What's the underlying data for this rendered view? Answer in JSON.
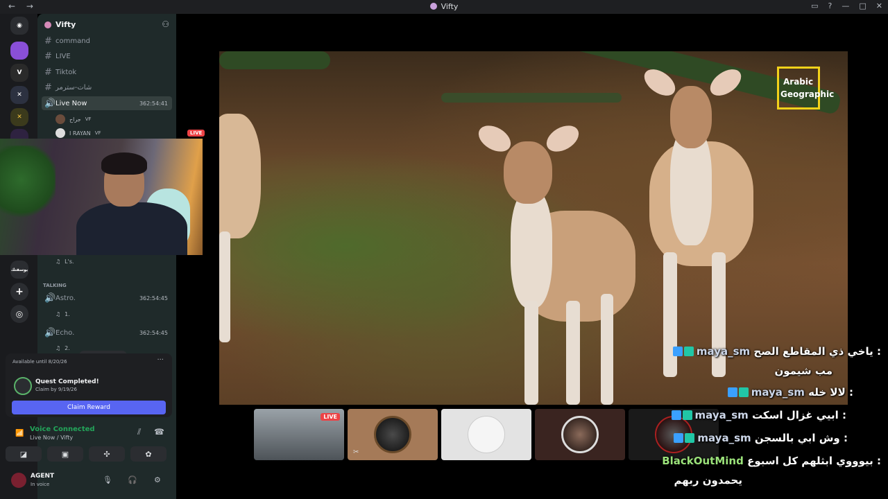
{
  "window": {
    "title": "Vifty"
  },
  "server": {
    "name": "Vifty"
  },
  "channels": [
    {
      "name": "command"
    },
    {
      "name": "LIVE"
    },
    {
      "name": "Tiktok"
    },
    {
      "name": "شات-سترمر"
    }
  ],
  "live_channel": {
    "name": "Live Now",
    "time": "362:54:41",
    "badge": "LIVE"
  },
  "voice_users": [
    {
      "name": "جراح",
      "tag": "VF"
    },
    {
      "name": "I RAYAN",
      "tag": "VF"
    }
  ],
  "other_user": {
    "name": "L's."
  },
  "category_talking": "TALKING",
  "talking_channels": [
    {
      "name": "Astro.",
      "time": "362:54:45",
      "user": "1."
    },
    {
      "name": "Echo.",
      "time": "362:54:45",
      "user": "2."
    }
  ],
  "new_unreads": "NEW UNREADS",
  "quest": {
    "available": "Available until 8/20/26",
    "title": "Quest Completed!",
    "subtitle": "Claim by 9/19/26",
    "button": "Claim Reward"
  },
  "voice_panel": {
    "status": "Voice Connected",
    "channel": "Live Now / Vifty"
  },
  "user_panel": {
    "name": "AGENT",
    "status": "In voice"
  },
  "watermark": {
    "line1": "Arabic",
    "line2": "Geographic"
  },
  "thumbnails": [
    {
      "badge": "LIVE"
    }
  ],
  "rail_label": "يوسفتك",
  "chat": [
    {
      "user": "maya_sm",
      "text": "ياخي ذي المقاطع الصح :"
    },
    {
      "user": "",
      "text": "مب شيمون"
    },
    {
      "user": "maya_sm",
      "text": "لالا خله :"
    },
    {
      "user": "maya_sm",
      "text": "ابيي غزال اسكت :"
    },
    {
      "user": "maya_sm",
      "text": "وش ابي بالسجن :"
    },
    {
      "user": "BlackOutMind",
      "text": "بيوووي ابثلهم كل اسبوع :"
    },
    {
      "user": "",
      "text": "يحمدون ربهم"
    }
  ]
}
